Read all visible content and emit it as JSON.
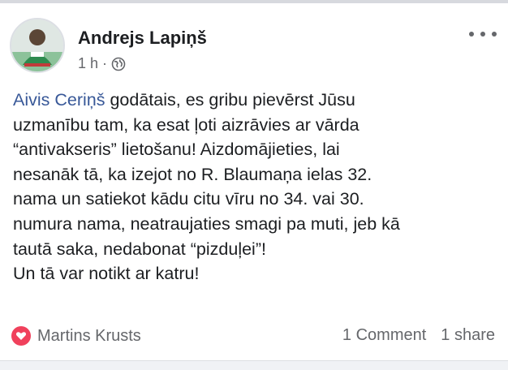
{
  "post": {
    "author": "Andrejs Lapiņš",
    "time": "1 h",
    "separator": "·",
    "privacy_icon": "globe-icon",
    "mention": "Aivis Ceriņš",
    "body_lines": [
      " godātais, es gribu pievērst Jūsu",
      "uzmanību tam, ka esat ļoti aizrāvies ar vārda",
      "“antivakseris” lietošanu! Aizdomājieties, lai",
      "nesanāk tā, ka izejot no R. Blaumaņa ielas 32.",
      "nama un satiekot kādu citu vīru no 34. vai 30.",
      "numura nama, neatraujaties smagi pa muti, jeb kā",
      "tautā saka, nedabonat “pizduļei”!",
      "Un tā var notikt ar katru!"
    ]
  },
  "footer": {
    "reaction_icon": "heart-icon",
    "reaction_name": "Martins Krusts",
    "comments": "1 Comment",
    "shares": "1 share"
  },
  "colors": {
    "mention": "#385898",
    "meta": "#65676b",
    "heart": "#f0415c",
    "text": "#1c1e21"
  }
}
